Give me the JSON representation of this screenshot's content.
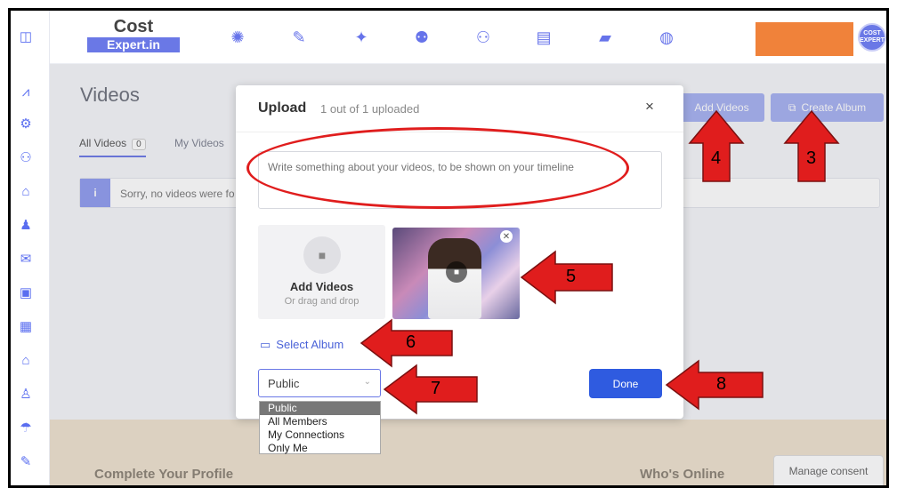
{
  "app": {
    "logo_line1": "Cost",
    "logo_line2": "Expert.in",
    "avatar_text": "COST EXPERT"
  },
  "page": {
    "title": "Videos",
    "tabs": [
      {
        "label": "All Videos",
        "count": "0"
      },
      {
        "label": "My Videos"
      }
    ],
    "notice": "Sorry, no videos were fo",
    "add_videos_btn": "Add Videos",
    "create_album_btn": "Create Album"
  },
  "modal": {
    "title": "Upload",
    "subtitle": "1 out of 1 uploaded",
    "close": "×",
    "textarea_placeholder": "Write something about your videos, to be shown on your timeline",
    "dropzone_title": "Add Videos",
    "dropzone_sub": "Or drag and drop",
    "select_album": "Select Album",
    "privacy_selected": "Public",
    "privacy_options": [
      "Public",
      "All Members",
      "My Connections",
      "Only Me"
    ],
    "done": "Done"
  },
  "footer": {
    "complete_profile": "Complete Your Profile",
    "whos_online": "Who's Online",
    "manage_consent": "Manage consent"
  },
  "annotations": [
    "3",
    "4",
    "5",
    "6",
    "7",
    "8"
  ],
  "colors": {
    "accent": "#6a78e6",
    "primary_button": "#2f5be0",
    "annotation_red": "#e01d1d",
    "orange_block": "#f0823a",
    "footer_band": "#eee2cf"
  }
}
